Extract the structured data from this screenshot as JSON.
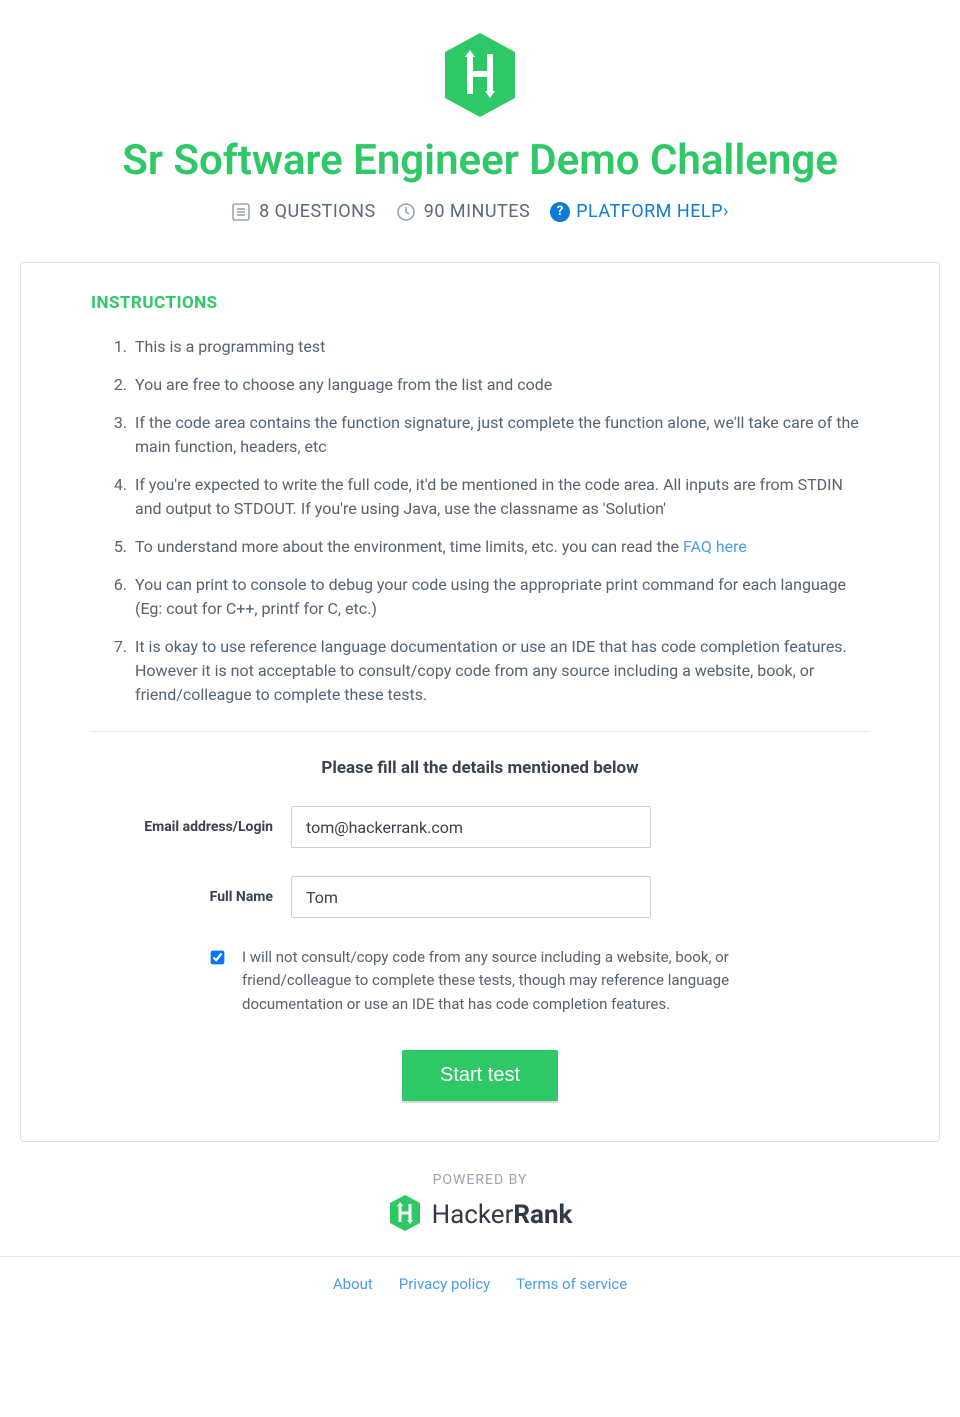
{
  "header": {
    "title": "Sr Software Engineer Demo Challenge",
    "questions_label": "8 QUESTIONS",
    "time_label": "90 MINUTES",
    "help_label": "PLATFORM HELP›"
  },
  "instructions": {
    "heading": "INSTRUCTIONS",
    "items": [
      "This is a programming test",
      "You are free to choose any language from the list and code",
      "If the code area contains the function signature, just complete the function alone, we'll take care of the main function, headers, etc",
      "If you're expected to write the full code, it'd be mentioned in the code area. All inputs are from STDIN and output to STDOUT. If you're using Java, use the classname as 'Solution'",
      "To understand more about the environment, time limits, etc. you can read the ",
      "You can print to console to debug your code using the appropriate print command for each language (Eg: cout for C++, printf for C, etc.)",
      "It is okay to use reference language documentation or use an IDE that has code completion features. However it is not acceptable to consult/copy code from any source including a website, book, or friend/colleague to complete these tests."
    ],
    "faq_link_text": "FAQ here"
  },
  "form": {
    "heading": "Please fill all the details mentioned below",
    "email_label": "Email address/Login",
    "email_value": "tom@hackerrank.com",
    "name_label": "Full Name",
    "name_value": "Tom",
    "consent_text": "I will not consult/copy code from any source including a website, book, or friend/colleague to complete these tests, though may reference language documentation or use an IDE that has code completion features.",
    "start_button": "Start test"
  },
  "footer": {
    "powered_by": "POWERED BY",
    "brand_plain": "Hacker",
    "brand_bold": "Rank",
    "links": {
      "about": "About",
      "privacy": "Privacy policy",
      "terms": "Terms of service"
    }
  }
}
